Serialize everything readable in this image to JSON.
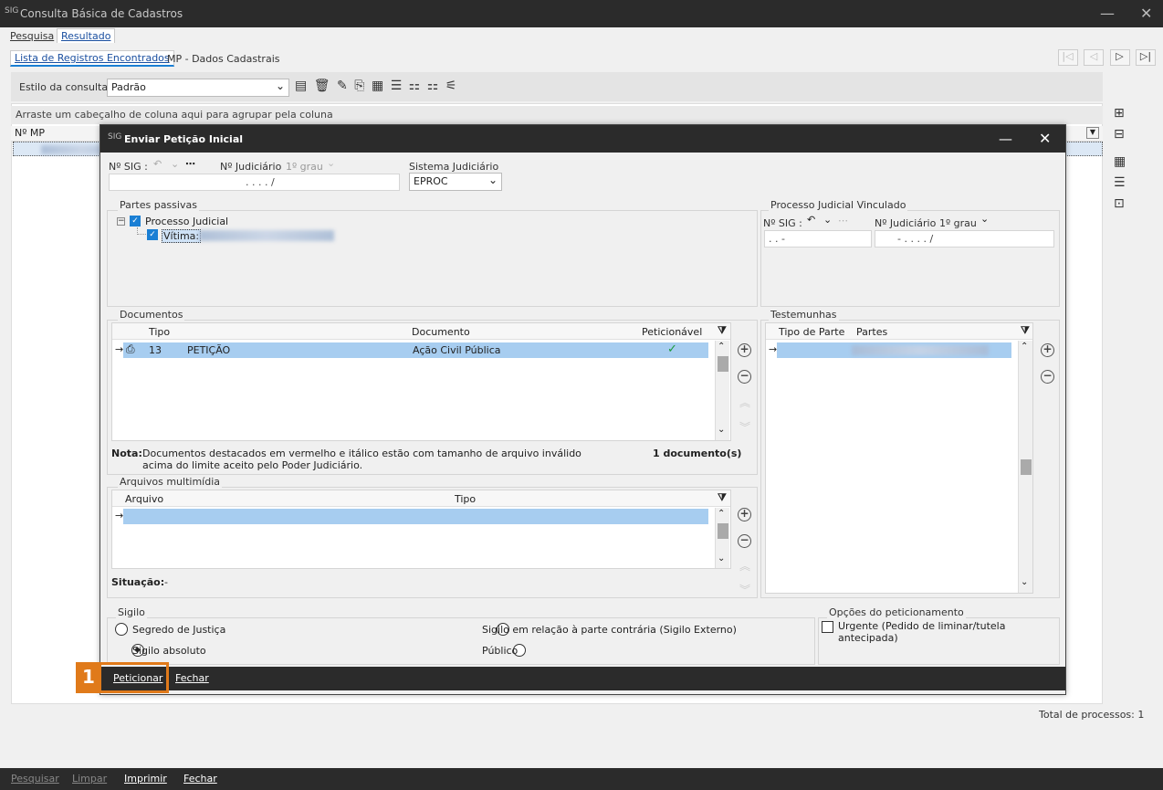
{
  "window": {
    "title": "Consulta Básica de Cadastros",
    "icon": "sig-app-icon",
    "minimize": "—",
    "close": "✕"
  },
  "tabs_top": [
    {
      "label": "Pesquisa"
    },
    {
      "label": "Resultado"
    }
  ],
  "tabs_inner": [
    {
      "label": "Lista de Registros Encontrados"
    },
    {
      "label": "MP - Dados Cadastrais"
    }
  ],
  "nav": {
    "first": "|◁",
    "prev": "◁",
    "next": "▷",
    "last": "▷|"
  },
  "toolbar": {
    "estilo_label": "Estilo da consulta",
    "estilo_value": "Padrão"
  },
  "grid": {
    "group_hint": "Arraste um cabeçalho de coluna aqui para agrupar pela coluna",
    "col_mp": "Nº MP"
  },
  "total": "Total de processos: 1",
  "bottom": {
    "pesquisar": "Pesquisar",
    "limpar": "Limpar",
    "imprimir": "Imprimir",
    "fechar": "Fechar"
  },
  "dialog": {
    "title": "Enviar Petição Inicial",
    "nsig_label": "Nº SIG :",
    "nsig_value": ". . . . /",
    "njud_label": "Nº Judiciário",
    "grau": "1º grau",
    "sistema_label": "Sistema Judiciário",
    "sistema_value": "EPROC",
    "partes": {
      "label": "Partes passivas",
      "root": "Processo Judicial",
      "child": "Vítima:"
    },
    "vinculado": {
      "label": "Processo Judicial Vinculado",
      "nsig_label": "Nº SIG :",
      "nsig_value": ". .      -",
      "njud_label": "Nº Judiciário",
      "grau": "1º grau",
      "njud_value": "- .  . . .  /"
    },
    "documentos": {
      "label": "Documentos",
      "col_tipo": "Tipo",
      "col_documento": "Documento",
      "col_peticionavel": "Peticionável",
      "row": {
        "num": "13",
        "tipo": "PETIÇÃO",
        "documento": "Ação Civil Pública"
      },
      "nota_label": "Nota:",
      "nota_text1": "Documentos destacados em vermelho e itálico estão com tamanho de arquivo inválido",
      "nota_text2": "acima do limite aceito pelo Poder Judiciário.",
      "count": "1 documento(s)"
    },
    "testemunhas": {
      "label": "Testemunhas",
      "col_tipo": "Tipo de Parte",
      "col_partes": "Partes"
    },
    "multimidia": {
      "label": "Arquivos multimídia",
      "col_arquivo": "Arquivo",
      "col_tipo": "Tipo"
    },
    "situacao_label": "Situação:",
    "situacao_value": "-",
    "sigilo": {
      "label": "Sigilo",
      "opt1": "Segredo de Justiça",
      "opt2": "Sigilo absoluto",
      "opt3": "Sigilo em relação à parte contrária (Sigilo Externo)",
      "opt4": "Público"
    },
    "opcoes": {
      "label": "Opções do peticionamento",
      "urgente": "Urgente (Pedido de liminar/tutela antecipada)"
    },
    "peticionar": "Peticionar",
    "fechar": "Fechar",
    "badge": "1"
  }
}
